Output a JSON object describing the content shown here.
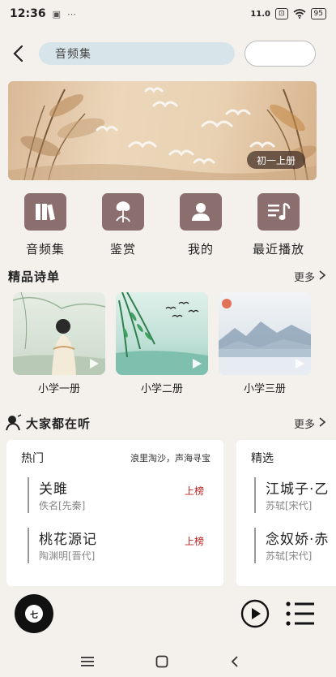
{
  "status": {
    "time": "12:36",
    "extra": "⋯",
    "speed": "11.0",
    "battery": "95"
  },
  "search": {
    "placeholder": "音频集"
  },
  "banner": {
    "tag": "初一上册"
  },
  "quicknav": [
    {
      "label": "音频集",
      "icon": "books-icon"
    },
    {
      "label": "鉴赏",
      "icon": "lotus-icon"
    },
    {
      "label": "我的",
      "icon": "person-icon"
    },
    {
      "label": "最近播放",
      "icon": "playlist-icon"
    }
  ],
  "featured": {
    "title": "精品诗单",
    "more": "更多",
    "cards": [
      {
        "label": "小学一册"
      },
      {
        "label": "小学二册"
      },
      {
        "label": "小学三册"
      }
    ]
  },
  "listening": {
    "title": "大家都在听",
    "more": "更多",
    "hot": {
      "header": "热门",
      "subtitle": "浪里淘沙，声海寻宝",
      "items": [
        {
          "title": "关雎",
          "author": "佚名[先秦]",
          "tag": "上榜"
        },
        {
          "title": "桃花源记",
          "author": "陶渊明[晋代]",
          "tag": "上榜"
        }
      ]
    },
    "picks": {
      "header": "精选",
      "items": [
        {
          "title": "江城子·乙",
          "author": "苏轼[宋代]"
        },
        {
          "title": "念奴娇·赤",
          "author": "苏轼[宋代]"
        }
      ]
    }
  },
  "player": {
    "disc_label": "七"
  },
  "colors": {
    "accent": "#8b6e6e",
    "hot_tag": "#b22222",
    "search_bg": "#d7e4ea"
  }
}
